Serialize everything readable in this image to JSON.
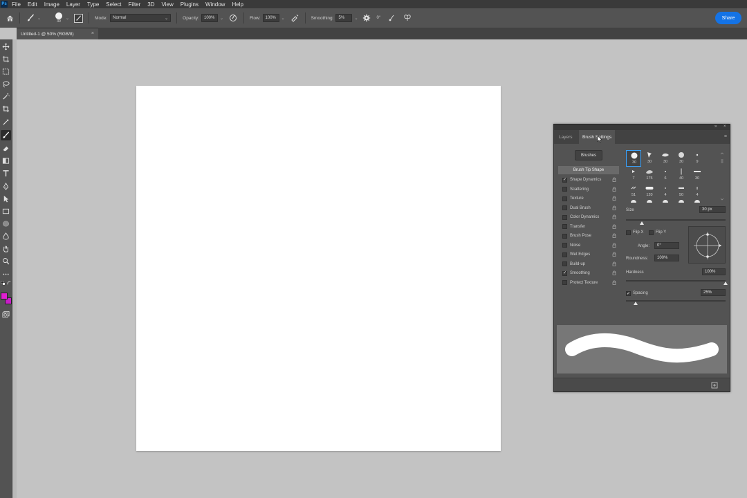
{
  "app": {
    "logo_text": "Ps"
  },
  "menu": [
    "File",
    "Edit",
    "Image",
    "Layer",
    "Type",
    "Select",
    "Filter",
    "3D",
    "View",
    "Plugins",
    "Window",
    "Help"
  ],
  "options_bar": {
    "brush_size": "30",
    "mode_label": "Mode:",
    "mode_value": "Normal",
    "opacity_label": "Opacity:",
    "opacity_value": "100%",
    "flow_label": "Flow:",
    "flow_value": "100%",
    "smoothing_label": "Smoothing:",
    "smoothing_value": "5%",
    "angle_value": "0°",
    "share_label": "Share"
  },
  "document_tab": {
    "title": "Untitled-1 @ 50% (RGB/8)",
    "close": "×"
  },
  "colors": {
    "foreground": "#e020d0",
    "background": "#c81ec8",
    "accent": "#1473e6",
    "selection": "#39a3ff"
  },
  "toolbar": {
    "tools": [
      "move-tool",
      "artboard-tool",
      "marquee-tool",
      "lasso-tool",
      "magic-wand-tool",
      "crop-tool",
      "eyedropper-tool",
      "brush-tool",
      "eraser-tool",
      "gradient-tool",
      "type-tool",
      "pen-tool",
      "path-selection-tool",
      "rectangle-tool",
      "ellipse-tool",
      "blur-tool",
      "hand-tool",
      "zoom-tool",
      "more-tools"
    ],
    "active_tool": "brush-tool"
  },
  "panel": {
    "tabs": [
      {
        "label": "Layers"
      },
      {
        "label": "Brush Settings"
      }
    ],
    "active_tab": "Brush Settings",
    "brushes_button": "Brushes",
    "brush_tip_shape": "Brush Tip Shape",
    "options": [
      {
        "label": "Shape Dynamics",
        "checked": true
      },
      {
        "label": "Scattering",
        "checked": false
      },
      {
        "label": "Texture",
        "checked": false
      },
      {
        "label": "Dual Brush",
        "checked": false
      },
      {
        "label": "Color Dynamics",
        "checked": false
      },
      {
        "label": "Transfer",
        "checked": false
      },
      {
        "label": "Brush Pose",
        "checked": false
      },
      {
        "label": "Noise",
        "checked": false
      },
      {
        "label": "Wet Edges",
        "checked": false
      },
      {
        "label": "Build-up",
        "checked": false
      },
      {
        "label": "Smoothing",
        "checked": true
      },
      {
        "label": "Protect Texture",
        "checked": false
      }
    ],
    "presets": [
      "30",
      "30",
      "30",
      "30",
      "9",
      "7",
      "175",
      "6",
      "40",
      "30",
      "51",
      "120",
      "4",
      "50",
      "4"
    ],
    "size_label": "Size",
    "size_value": "30 px",
    "size_fraction": 0.16,
    "flip_x": "Flip X",
    "flip_y": "Flip Y",
    "angle_label": "Angle:",
    "angle_value": "0°",
    "roundness_label": "Roundness:",
    "roundness_value": "100%",
    "hardness_label": "Hardness",
    "hardness_value": "100%",
    "hardness_fraction": 1.0,
    "spacing_label": "Spacing",
    "spacing_checked": true,
    "spacing_value": "25%",
    "spacing_fraction": 0.1
  }
}
